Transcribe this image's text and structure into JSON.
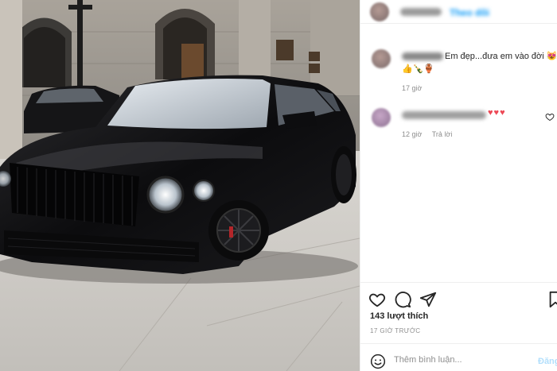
{
  "post": {
    "photo_alt": "black luxury car parked on street",
    "header": {
      "username": "",
      "follow_label": "Theo dõi"
    },
    "comments": [
      {
        "text": "Em đẹp...đưa em vào đời",
        "emoji_trailing": "😻",
        "emoji_row": "👍🍾🏺",
        "time": "17 giờ"
      },
      {
        "text": "",
        "hearts": "♥♥♥",
        "time": "12 giờ",
        "reply_label": "Trả lời"
      }
    ],
    "actions": {
      "like_icon": "heart-outline-icon",
      "comment_icon": "speech-bubble-icon",
      "share_icon": "paper-plane-icon",
      "save_icon": "bookmark-icon"
    },
    "likes_label": "143 lượt thích",
    "time_ago": "17 GIỜ TRƯỚC",
    "add_comment": {
      "placeholder": "Thêm bình luận...",
      "post_label": "Đăng"
    }
  },
  "colors": {
    "accent": "#0095f6",
    "heart": "#ed4956",
    "muted": "#8e8e8e",
    "text": "#262626"
  }
}
